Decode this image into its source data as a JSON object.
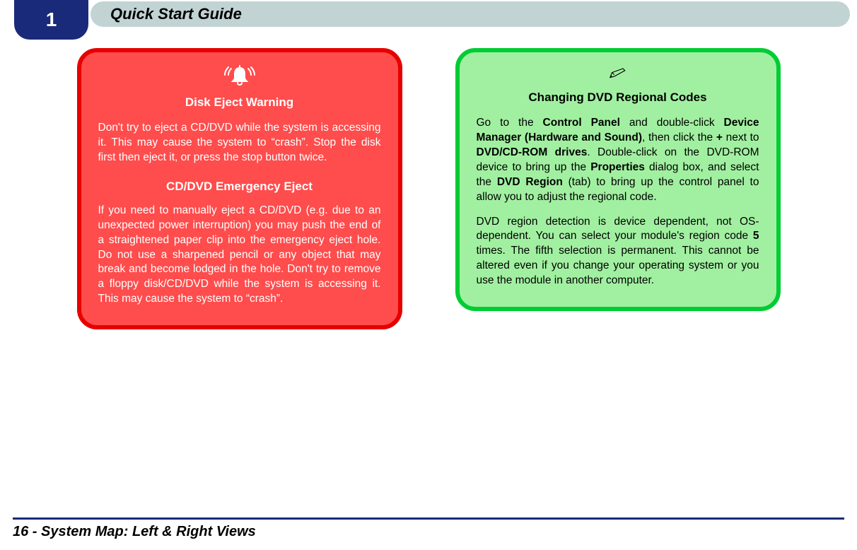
{
  "header": {
    "chapter_number": "1",
    "title": "Quick Start Guide"
  },
  "warning_box": {
    "icon": "alarm-icon",
    "title": "Disk Eject Warning",
    "paragraph1": "Don't try to eject a CD/DVD while the system is ac­cessing it. This may cause the system to “crash”. Stop the disk first then eject it, or press the stop button twice.",
    "subtitle": "CD/DVD Emergency Eject",
    "paragraph2": "If you need to manually eject a CD/DVD (e.g. due to an unexpected power interruption) you may push the end of a straightened paper clip into the emergency eject hole. Do not use a sharpened pencil or any ob­ject that may break and become lodged in the hole. Don't try to remove a floppy disk/CD/DVD while the system is accessing it. This may cause the system to “crash”."
  },
  "note_box": {
    "icon": "pencil-icon",
    "title": "Changing DVD Regional Codes",
    "p1_parts": {
      "t1": "Go to the ",
      "b1": "Control Panel",
      "t2": " and double-click ",
      "b2": "Device Manager (Hardware and Sound)",
      "t3": ", then click the ",
      "b3": "+",
      "t4": " next to ",
      "b4": "DVD/CD-ROM drives",
      "t5": ". Double-click on the DVD-ROM device to bring up the ",
      "b5": "Properties",
      "t6": " dialog box, and select the ",
      "b6": "DVD Region",
      "t7": " (tab) to bring up the control panel to allow you to adjust the regional code."
    },
    "p2_parts": {
      "t1": "DVD region detection is device dependent, not OS-dependent. You can select your module's region code ",
      "b1": "5",
      "t2": " times. The fifth selection is permanent. This cannot be altered even if you change your operating system or you use the module in another computer."
    }
  },
  "footer": {
    "text": "16 - System Map: Left & Right Views"
  }
}
